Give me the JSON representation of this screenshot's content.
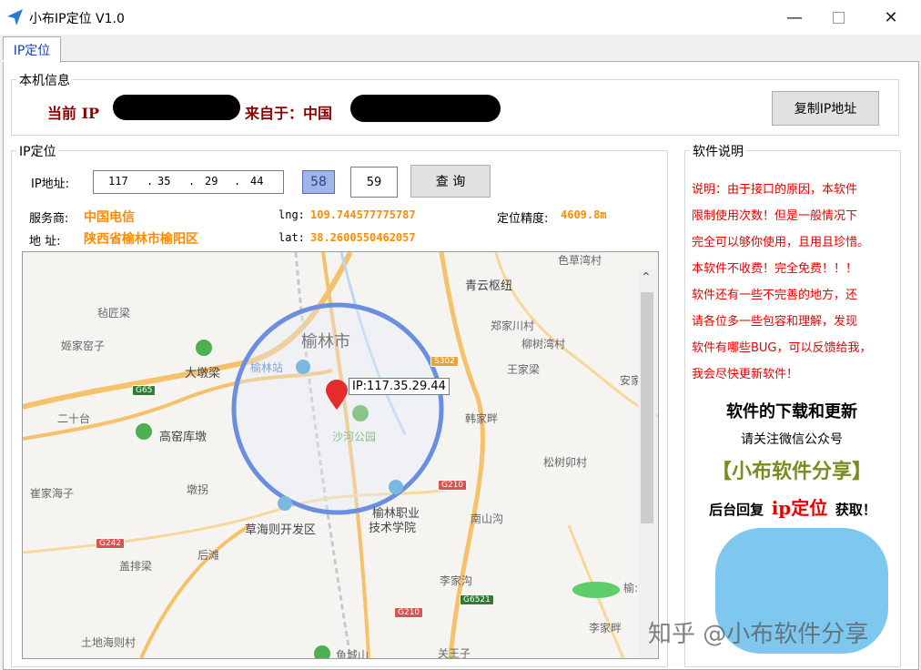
{
  "window": {
    "title": "小布IP定位 V1.0"
  },
  "tabs": [
    {
      "label": "IP定位"
    }
  ],
  "local_info": {
    "group_title": "本机信息",
    "current_label": "当前 IP",
    "from_label": "来自于：中国",
    "copy_button": "复制IP地址"
  },
  "ip_locate": {
    "group_title": "IP定位",
    "ip_label": "IP地址:",
    "ip_octets": [
      "117",
      "35",
      "29",
      "44"
    ],
    "small_box_value": "58",
    "num_box_value": "59",
    "query_button": "查 询",
    "isp_label": "服务商:",
    "isp_value": "中国电信",
    "lng_label": "lng:",
    "lng_value": "109.744577775787",
    "accuracy_label": "定位精度:",
    "accuracy_value": "4609.8m",
    "address_label": "地 址:",
    "address_value": "陕西省榆林市榆阳区",
    "lat_label": "lat:",
    "lat_value": "38.2600550462057"
  },
  "map": {
    "marker_label": "IP:117.35.29.44",
    "city_label": "榆林市",
    "places": {
      "qingyun": "青云枢纽",
      "sekuwan": "色草湾村",
      "zhanliang": "毡匠梁",
      "zhengjiachuan": "郑家川村",
      "jiajiayaozi": "姬家窑子",
      "liushuwan": "柳树湾村",
      "dadunliang": "大墩梁",
      "yulin_station": "榆林站",
      "wangjialiang": "王家梁",
      "anjia": "安家",
      "ershitai": "二十台",
      "hanjiapan": "韩家畔",
      "gaoyao": "高窑库墩",
      "shahe": "沙河公园",
      "songshu": "松树卯村",
      "cuijia": "崔家海子",
      "dunguai": "墩拐",
      "zhiye1": "榆林职业",
      "zhiye2": "技术学院",
      "nanshan": "南山沟",
      "caohai": "草海则开发区",
      "paipailiang": "盖排梁",
      "houtan": "后滩",
      "lijiagou": "李家沟",
      "lijiapan": "李家畔",
      "tuditu": "土地海则村",
      "yucheng": "鱼城山",
      "guanwang": "关王子",
      "yuzhao": "榆:"
    },
    "roads": {
      "g65": "G65",
      "s302": "S302",
      "g210a": "G210",
      "g210b": "G210",
      "g242": "G242",
      "g6521": "G6521"
    }
  },
  "software_info": {
    "group_title": "软件说明",
    "notes": [
      "说明：由于接口的原因，本软件",
      "限制使用次数！但是一般情况下",
      "完全可以够你使用，且用且珍惜。",
      "本软件不收费！完全免费！！！",
      "软件还有一些不完善的地方，还",
      "请各位多一些包容和理解，发现",
      "软件有哪些BUG，可以反馈给我，",
      "我会尽快更新软件！"
    ],
    "download_title": "软件的下载和更新",
    "follow_text": "请关注微信公众号",
    "account_name": "【小布软件分享】",
    "reply_prefix": "后台回复",
    "reply_keyword": "ip定位",
    "reply_suffix": "获取！"
  },
  "watermark": "知乎 @小布软件分享",
  "colors": {
    "accent_red": "#e60000",
    "dark_red": "#8b0000",
    "orange": "#ff8c00",
    "title_blue": "#1a3fb0"
  }
}
